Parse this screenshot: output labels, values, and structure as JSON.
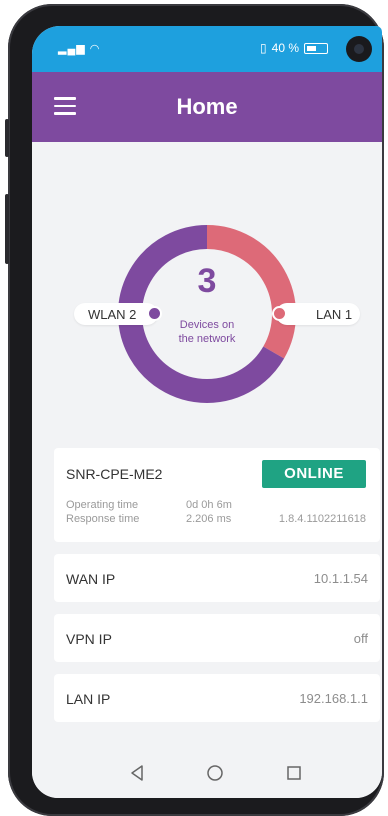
{
  "status_bar": {
    "left_icons": [
      "signal-icon",
      "wifi-icon"
    ],
    "battery_text": "40 %"
  },
  "app_bar": {
    "title": "Home"
  },
  "network_chart": {
    "count": "3",
    "center_label_line1": "Devices on",
    "center_label_line2": "the network",
    "left_label": "WLAN 2",
    "right_label": "LAN 1",
    "colors": {
      "wlan": "#7e4a9f",
      "lan": "#dd6a78"
    },
    "chart_data": {
      "type": "pie",
      "categories": [
        "WLAN 2",
        "LAN 1"
      ],
      "values": [
        2,
        1
      ]
    }
  },
  "device": {
    "name": "SNR-CPE-ME2",
    "status": "ONLINE",
    "operating_time_label": "Operating time",
    "operating_time_value": "0d 0h 6m",
    "response_time_label": "Response time",
    "response_time_value": "2.206 ms",
    "firmware": "1.8.4.1102211618"
  },
  "info_rows": [
    {
      "label": "WAN IP",
      "value": "10.1.1.54"
    },
    {
      "label": "VPN IP",
      "value": "off"
    },
    {
      "label": "LAN IP",
      "value": "192.168.1.1"
    }
  ],
  "colors": {
    "status_bar": "#1ea0de",
    "app_bar": "#7e4a9f",
    "online": "#1fa383"
  },
  "nav_icons": [
    "back-icon",
    "home-icon",
    "recents-icon"
  ]
}
